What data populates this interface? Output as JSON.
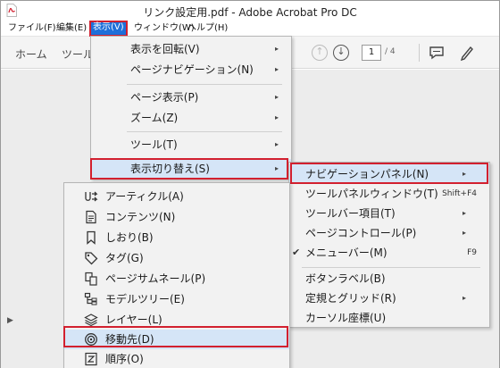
{
  "window": {
    "title": "リンク設定用.pdf - Adobe Acrobat Pro DC"
  },
  "menubar": {
    "items": [
      {
        "label": "ファイル(F)"
      },
      {
        "label": "編集(E)"
      },
      {
        "label": "表示(V)"
      },
      {
        "label": "ウィンドウ(W)"
      },
      {
        "label": "ヘルプ(H)"
      }
    ]
  },
  "toolbar": {
    "home": "ホーム",
    "tools": "ツール",
    "page_current": "1",
    "page_total": "/ 4"
  },
  "view_menu": {
    "items": [
      {
        "label": "表示を回転(V)",
        "arrow": "▸"
      },
      {
        "label": "ページナビゲーション(N)",
        "arrow": "▸"
      },
      {
        "label": "ページ表示(P)",
        "arrow": "▸"
      },
      {
        "label": "ズーム(Z)",
        "arrow": "▸"
      },
      {
        "label": "ツール(T)",
        "arrow": "▸"
      },
      {
        "label": "表示切り替え(S)",
        "arrow": "▸"
      }
    ]
  },
  "toggle_menu": {
    "items": [
      {
        "label": "ナビゲーションパネル(N)",
        "arrow": "▸",
        "shortcut": ""
      },
      {
        "label": "ツールパネルウィンドウ(T)",
        "arrow": "",
        "shortcut": "Shift+F4"
      },
      {
        "label": "ツールバー項目(T)",
        "arrow": "▸",
        "shortcut": ""
      },
      {
        "label": "ページコントロール(P)",
        "arrow": "▸",
        "shortcut": ""
      },
      {
        "label": "メニューバー(M)",
        "arrow": "",
        "shortcut": "F9",
        "check": "✔"
      },
      {
        "label": "ボタンラベル(B)",
        "arrow": "▸",
        "shortcut": ""
      },
      {
        "label": "定規とグリッド(R)",
        "arrow": "▸",
        "shortcut": ""
      },
      {
        "label": "カーソル座標(U)",
        "arrow": "",
        "shortcut": ""
      }
    ]
  },
  "nav_panel_menu": {
    "items": [
      {
        "label": "アーティクル(A)",
        "icon": "article-icon"
      },
      {
        "label": "コンテンツ(N)",
        "icon": "content-icon"
      },
      {
        "label": "しおり(B)",
        "icon": "bookmark-icon"
      },
      {
        "label": "タグ(G)",
        "icon": "tag-icon"
      },
      {
        "label": "ページサムネール(P)",
        "icon": "page-thumbnail-icon"
      },
      {
        "label": "モデルツリー(E)",
        "icon": "model-tree-icon"
      },
      {
        "label": "レイヤー(L)",
        "icon": "layers-icon"
      },
      {
        "label": "移動先(D)",
        "icon": "destination-icon"
      },
      {
        "label": "順序(O)",
        "icon": "order-icon"
      }
    ]
  },
  "colors": {
    "highlight_border": "#d2202f",
    "menu_active": "#1e6fd9",
    "hover_fill": "#d5e5f7"
  }
}
